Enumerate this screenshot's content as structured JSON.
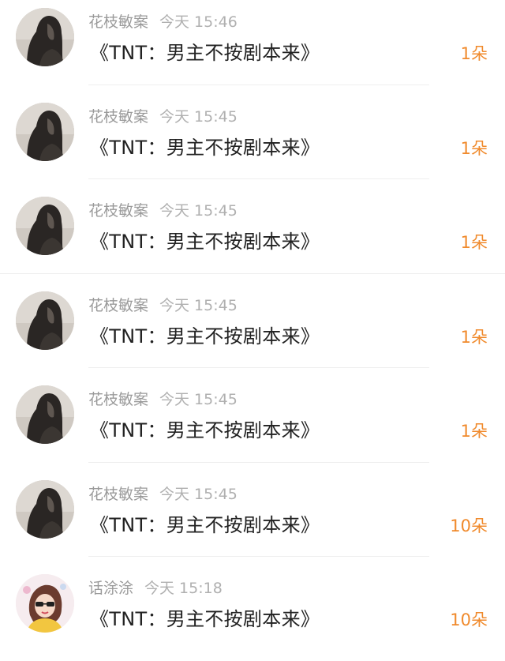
{
  "messages": [
    {
      "user": "花枝敏案",
      "time": "今天 15:46",
      "text": "《TNT：男主不按剧本来》",
      "count": "1朵",
      "avatar": "dark-hair-avatar"
    },
    {
      "user": "花枝敏案",
      "time": "今天 15:45",
      "text": "《TNT：男主不按剧本来》",
      "count": "1朵",
      "avatar": "dark-hair-avatar"
    },
    {
      "user": "花枝敏案",
      "time": "今天 15:45",
      "text": "《TNT：男主不按剧本来》",
      "count": "1朵",
      "avatar": "dark-hair-avatar"
    },
    {
      "user": "花枝敏案",
      "time": "今天 15:45",
      "text": "《TNT：男主不按剧本来》",
      "count": "1朵",
      "avatar": "dark-hair-avatar"
    },
    {
      "user": "花枝敏案",
      "time": "今天 15:45",
      "text": "《TNT：男主不按剧本来》",
      "count": "1朵",
      "avatar": "dark-hair-avatar"
    },
    {
      "user": "花枝敏案",
      "time": "今天 15:45",
      "text": "《TNT：男主不按剧本来》",
      "count": "10朵",
      "avatar": "dark-hair-avatar"
    },
    {
      "user": "话涂涂",
      "time": "今天 15:18",
      "text": "《TNT：男主不按剧本来》",
      "count": "10朵",
      "avatar": "illustrated-girl-avatar"
    }
  ],
  "colors": {
    "accent": "#f08a2c",
    "username": "#9a9a9a",
    "text": "#222222"
  }
}
